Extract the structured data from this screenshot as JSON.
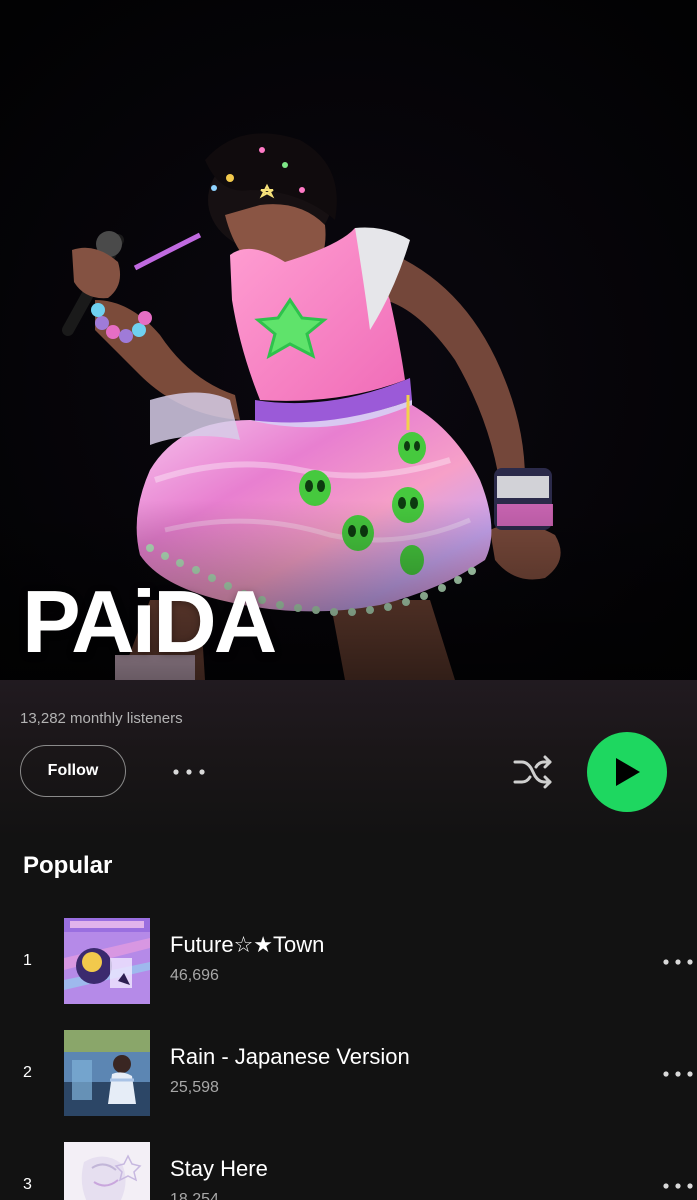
{
  "artist": {
    "name": "PAiDA",
    "monthly_listeners": "13,282 monthly listeners"
  },
  "controls": {
    "follow_label": "Follow",
    "more_icon": "more-horizontal-icon",
    "shuffle_icon": "shuffle-icon",
    "play_icon": "play-icon"
  },
  "popular": {
    "title": "Popular",
    "tracks": [
      {
        "rank": "1",
        "title": "Future☆★Town",
        "plays": "46,696"
      },
      {
        "rank": "2",
        "title": "Rain - Japanese Version",
        "plays": "25,598"
      },
      {
        "rank": "3",
        "title": "Stay Here",
        "plays": "18,254"
      }
    ]
  },
  "colors": {
    "background": "#121212",
    "accent": "#1ed760",
    "text_secondary": "#b3b3b3"
  }
}
